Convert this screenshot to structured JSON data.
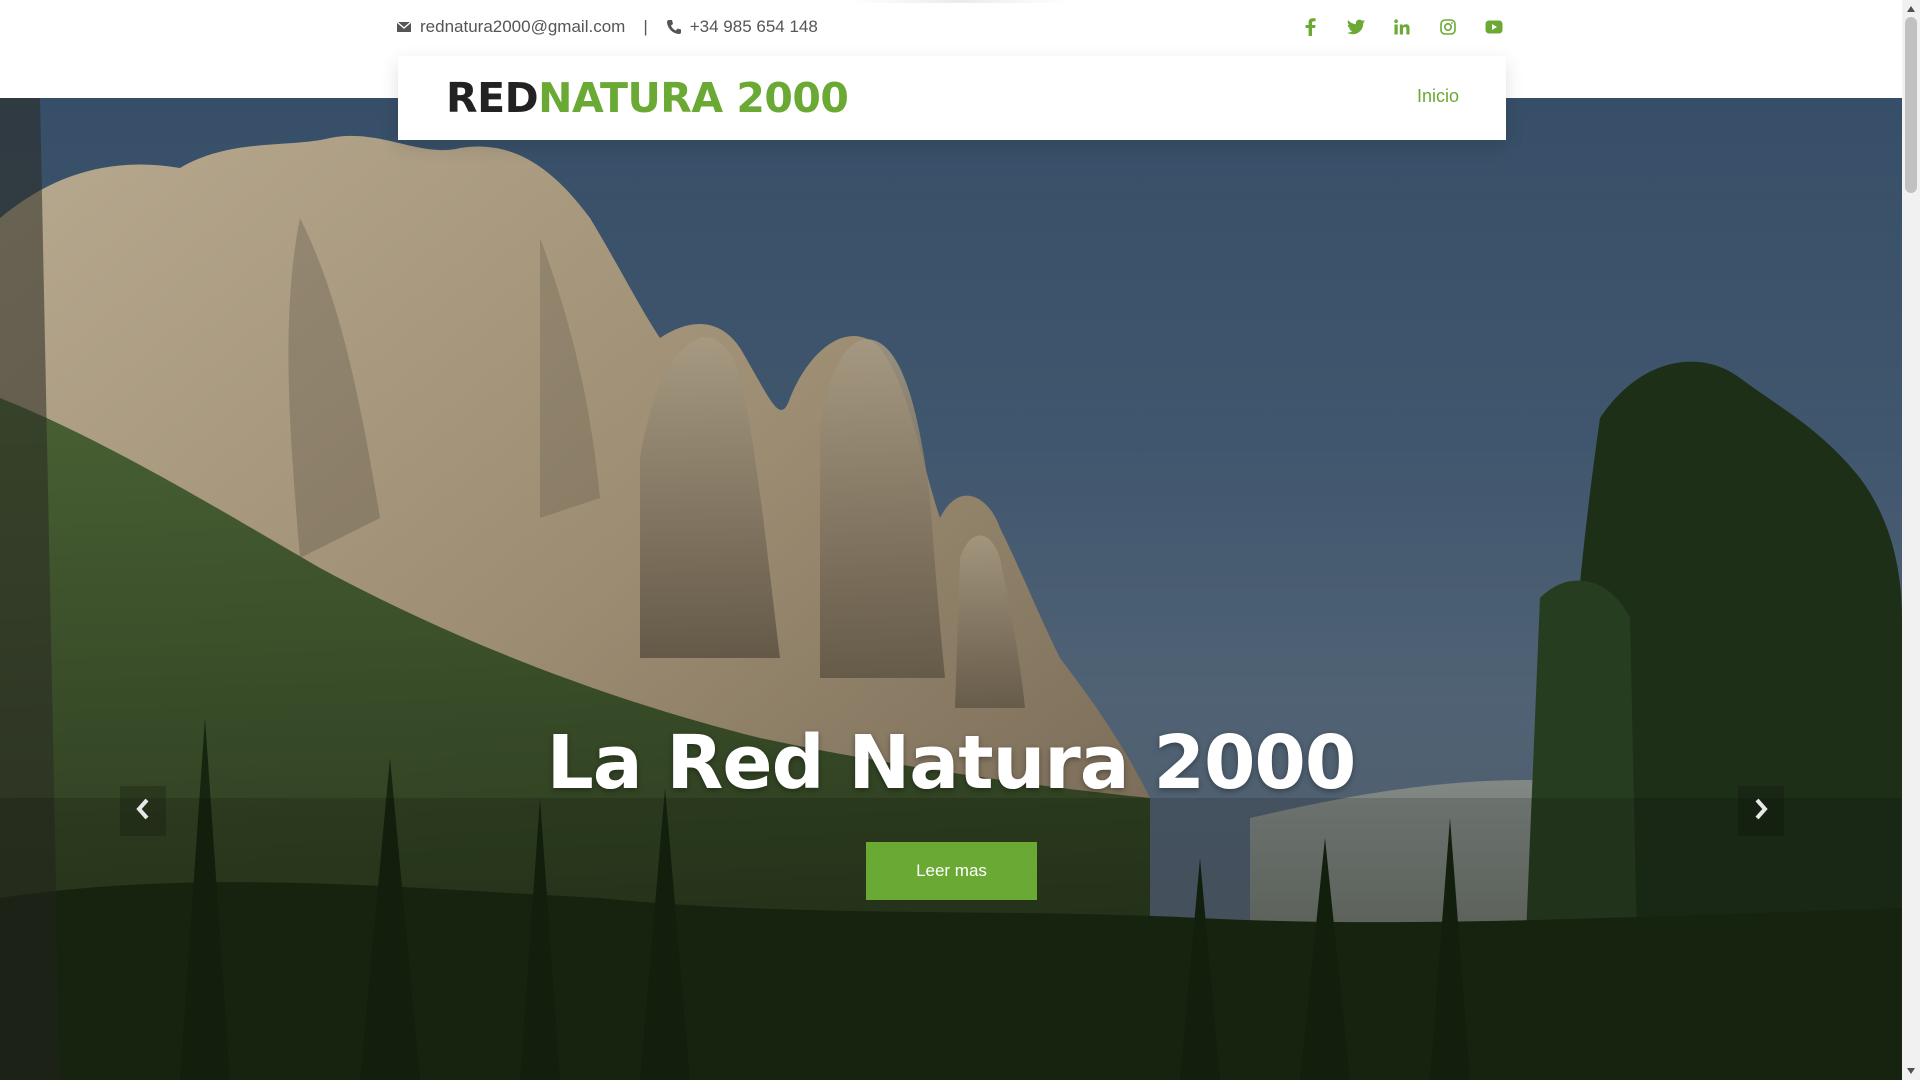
{
  "topbar": {
    "email": "rednatura2000@gmail.com",
    "separator": "|",
    "phone": "+34 985 654 148",
    "social": [
      "facebook-icon",
      "twitter-icon",
      "linkedin-icon",
      "instagram-icon",
      "youtube-icon"
    ]
  },
  "header": {
    "logo_part1": "RED",
    "logo_part2": "NATURA 2000",
    "nav": {
      "inicio": "Inicio"
    }
  },
  "hero": {
    "title": "La Red Natura 2000",
    "cta_label": "Leer mas",
    "prev_icon": "chevron-left-icon",
    "next_icon": "chevron-right-icon"
  },
  "colors": {
    "accent": "#6aa934",
    "logo_dark": "#222222",
    "text": "#555555"
  }
}
